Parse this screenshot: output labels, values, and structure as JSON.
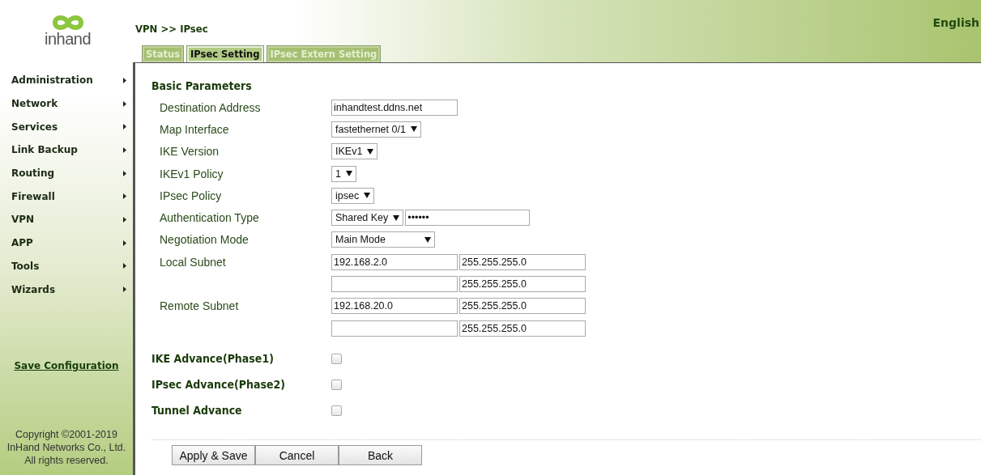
{
  "logo": {
    "text": "inhand"
  },
  "header": {
    "breadcrumb": "VPN >> IPsec",
    "language": "English"
  },
  "tabs": [
    {
      "label": "Status",
      "selected": false
    },
    {
      "label": "IPsec Setting",
      "selected": true
    },
    {
      "label": "IPsec Extern Setting",
      "selected": false
    }
  ],
  "sidebar": {
    "items": [
      {
        "label": "Administration"
      },
      {
        "label": "Network"
      },
      {
        "label": "Services"
      },
      {
        "label": "Link Backup"
      },
      {
        "label": "Routing"
      },
      {
        "label": "Firewall"
      },
      {
        "label": "VPN"
      },
      {
        "label": "APP"
      },
      {
        "label": "Tools"
      },
      {
        "label": "Wizards"
      }
    ],
    "save_link": "Save Configuration",
    "copyright": [
      "Copyright ©2001-2019",
      "InHand Networks Co., Ltd.",
      "All rights reserved."
    ]
  },
  "section_title": "Basic Parameters",
  "fields": [
    {
      "kind": "text",
      "label": "Destination Address",
      "value": "inhandtest.ddns.net"
    },
    {
      "kind": "select",
      "label": "Map Interface",
      "value": "fastethernet 0/1"
    },
    {
      "kind": "select",
      "label": "IKE Version",
      "value": "IKEv1"
    },
    {
      "kind": "select",
      "label": "IKEv1 Policy",
      "value": "1"
    },
    {
      "kind": "select",
      "label": "IPsec Policy",
      "value": "ipsec"
    },
    {
      "kind": "select_secret",
      "label": "Authentication Type",
      "value": "Shared Key",
      "secret": "••••••"
    },
    {
      "kind": "select",
      "label": "Negotiation Mode",
      "value": "Main Mode"
    },
    {
      "kind": "subnet",
      "label": "Local Subnet",
      "address": "192.168.2.0",
      "mask": "255.255.255.0"
    },
    {
      "kind": "subnet",
      "mask": "255.255.255.0"
    },
    {
      "kind": "subnet",
      "label": "Remote Subnet",
      "address": "192.168.20.0",
      "mask": "255.255.255.0"
    },
    {
      "kind": "subnet",
      "mask": "255.255.255.0"
    }
  ],
  "options": [
    {
      "label": "IKE Advance(Phase1)",
      "checked": false
    },
    {
      "label": "IPsec Advance(Phase2)",
      "checked": false
    },
    {
      "label": "Tunnel Advance",
      "checked": false
    }
  ],
  "buttons": [
    "Apply & Save",
    "Cancel",
    "Back"
  ]
}
